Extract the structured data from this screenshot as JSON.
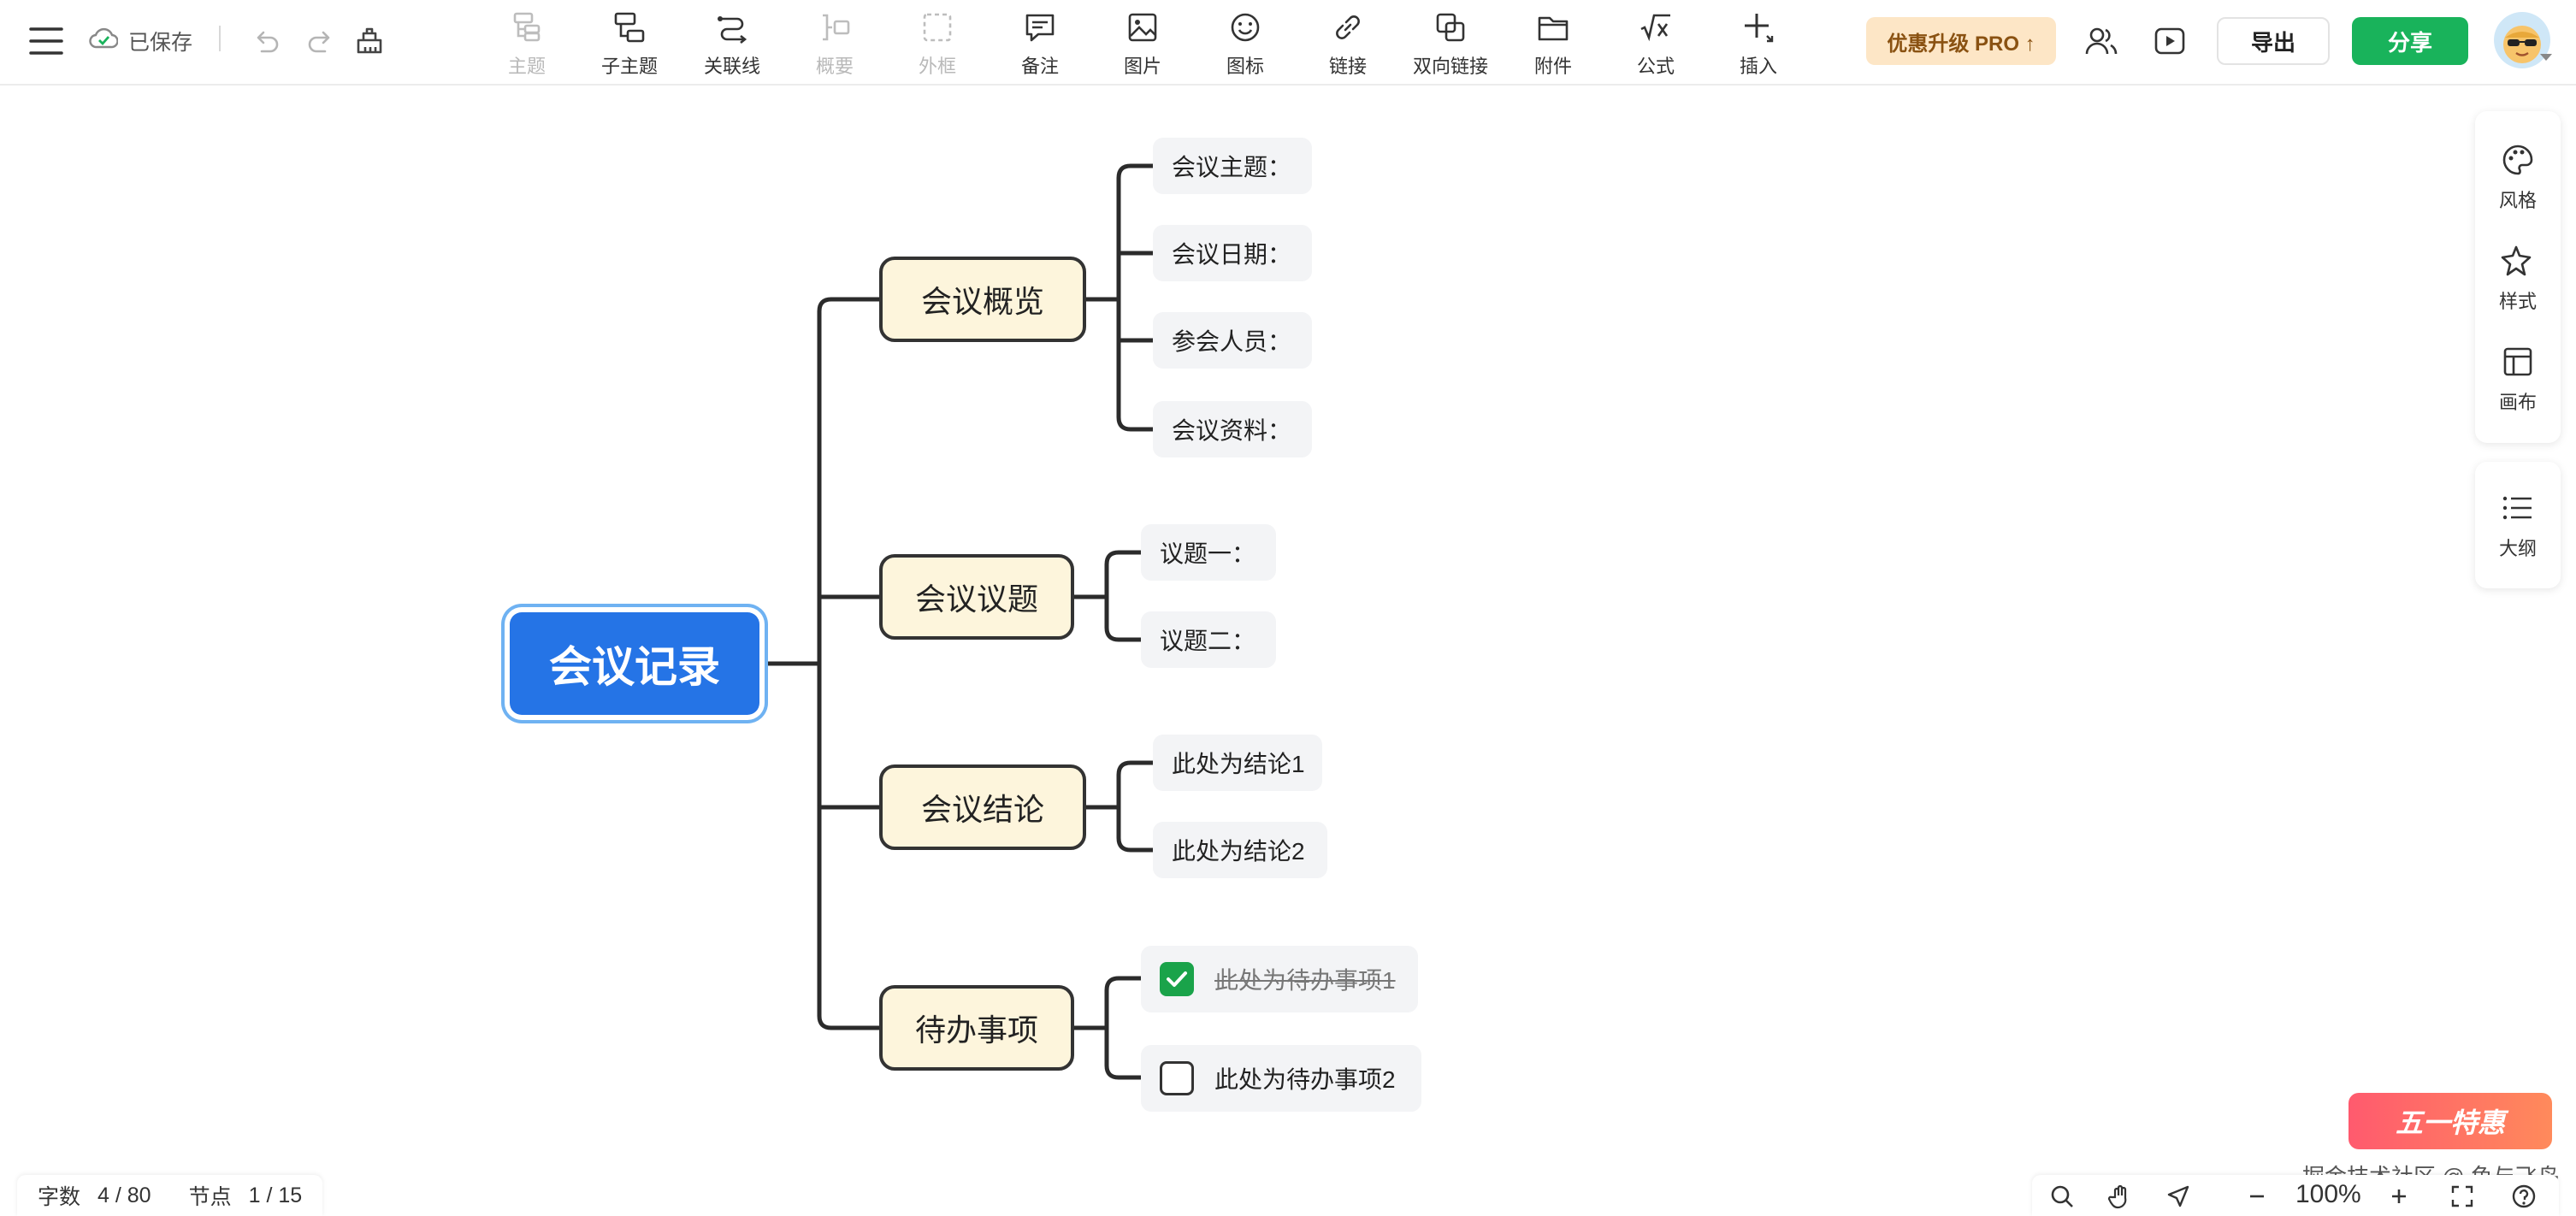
{
  "header": {
    "saved_label": "已保存",
    "tools": [
      {
        "label": "主题",
        "icon": "topic-icon",
        "enabled": false
      },
      {
        "label": "子主题",
        "icon": "subtopic-icon",
        "enabled": true
      },
      {
        "label": "关联线",
        "icon": "relation-line-icon",
        "enabled": true
      },
      {
        "label": "概要",
        "icon": "summary-icon",
        "enabled": false
      },
      {
        "label": "外框",
        "icon": "boundary-icon",
        "enabled": false
      },
      {
        "label": "备注",
        "icon": "note-icon",
        "enabled": true
      },
      {
        "label": "图片",
        "icon": "image-icon",
        "enabled": true
      },
      {
        "label": "图标",
        "icon": "emoji-icon",
        "enabled": true
      },
      {
        "label": "链接",
        "icon": "link-icon",
        "enabled": true
      },
      {
        "label": "双向链接",
        "icon": "bidirectional-link-icon",
        "enabled": true
      },
      {
        "label": "附件",
        "icon": "attachment-icon",
        "enabled": true
      },
      {
        "label": "公式",
        "icon": "formula-icon",
        "enabled": true
      },
      {
        "label": "插入",
        "icon": "insert-icon",
        "enabled": true
      }
    ],
    "pro_label": "优惠升级 PRO ↑",
    "export_label": "导出",
    "share_label": "分享"
  },
  "mindmap": {
    "root": "会议记录",
    "branches": [
      {
        "label": "会议概览",
        "children": [
          "会议主题：",
          "会议日期：",
          "参会人员：",
          "会议资料："
        ]
      },
      {
        "label": "会议议题",
        "children": [
          "议题一：",
          "议题二："
        ]
      },
      {
        "label": "会议结论",
        "children": [
          "此处为结论1",
          "此处为结论2"
        ]
      },
      {
        "label": "待办事项",
        "todos": [
          {
            "text": "此处为待办事项1",
            "done": true
          },
          {
            "text": "此处为待办事项2",
            "done": false
          }
        ]
      }
    ]
  },
  "right_panel": {
    "items": [
      {
        "label": "风格",
        "icon": "palette-icon"
      },
      {
        "label": "样式",
        "icon": "style-icon"
      },
      {
        "label": "画布",
        "icon": "canvas-icon"
      }
    ],
    "outline_label": "大纲"
  },
  "status": {
    "word_label": "字数",
    "word_value": "4 / 80",
    "node_label": "节点",
    "node_value": "1 / 15"
  },
  "zoom": {
    "value": "100%"
  },
  "promo": {
    "label": "五一特惠"
  },
  "watermark": "掘金技术社区 @ 鱼与飞鸟",
  "colors": {
    "root_bg": "#2574e6",
    "branch_bg": "#fdf5dc",
    "leaf_bg": "#f3f4f6",
    "share_button": "#19b35b",
    "pro_button": "#fde6c6",
    "todo_done": "#1aa34a"
  }
}
